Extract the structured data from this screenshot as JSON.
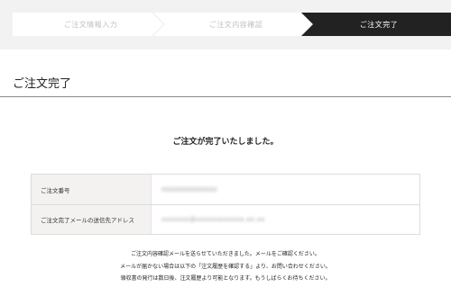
{
  "steps": [
    {
      "label": "ご注文情報入力",
      "active": false
    },
    {
      "label": "ご注文内容確認",
      "active": false
    },
    {
      "label": "ご注文完了",
      "active": true
    }
  ],
  "page": {
    "title": "ご注文完了",
    "message": "ご注文が完了いたしました。"
  },
  "order_info": {
    "rows": [
      {
        "label": "ご注文番号",
        "value": "0000000000000"
      },
      {
        "label": "ご注文完了メールの送信先アドレス",
        "value": "xxxxxxx@xxxxxxxxxxxx.xx.xx"
      }
    ]
  },
  "notes": [
    "ご注文内容確認メールを送らせていただきました。メールをご確認ください。",
    "メールが届かない場合は以下の「注文履歴を確認する」より、お問い合わせください。",
    "領収書の発行は数日後、注文履歴より可能となります。もうしばらくお待ちください。"
  ],
  "colors": {
    "active_step": "#222222",
    "inactive_step_text": "#c0c0c0",
    "table_label_bg": "#f3f2f0"
  }
}
